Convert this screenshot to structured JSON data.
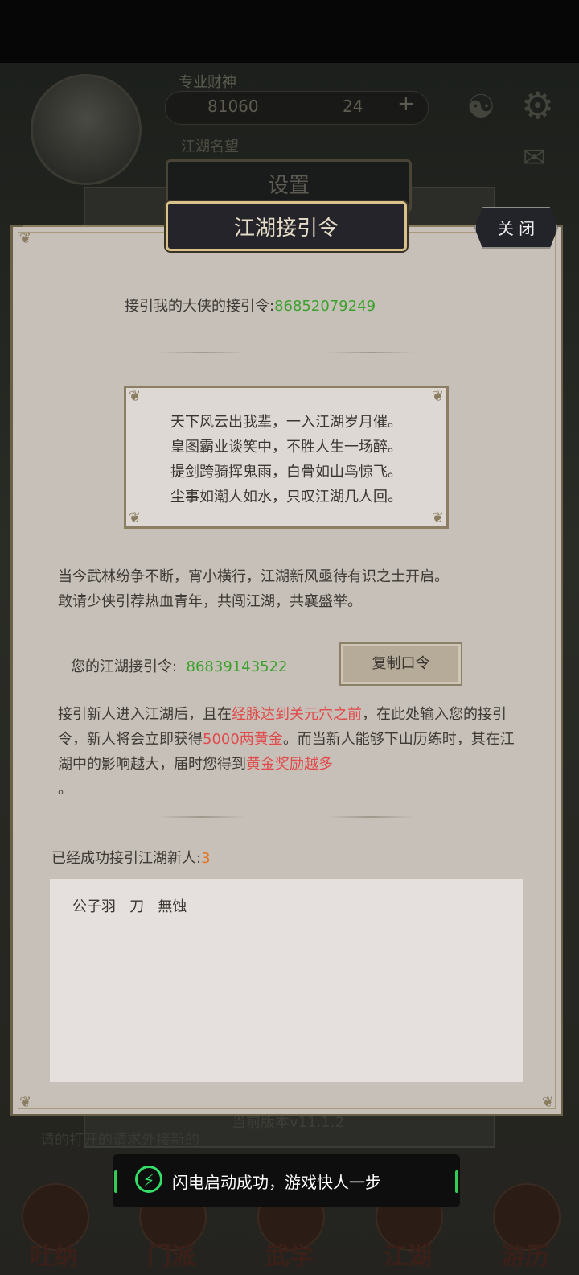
{
  "background": {
    "hud": {
      "player_name": "专业财神",
      "gold": "81060",
      "gems": "24",
      "plus": "+",
      "subtitle": "江湖名望"
    },
    "settings_title": "设置",
    "version": "当前版本v11.1.2",
    "note": "请的打开的请求外接新的"
  },
  "bottom_nav": [
    {
      "label": "吐纳"
    },
    {
      "label": "门派"
    },
    {
      "label": "武学"
    },
    {
      "label": "江湖"
    },
    {
      "label": "游历"
    }
  ],
  "dialog": {
    "title": "江湖接引令",
    "close_label": "关 闭",
    "inviter_label": "接引我的大侠的接引令:",
    "inviter_code": "86852079249",
    "poem": [
      "天下风云出我辈，一入江湖岁月催。",
      "皇图霸业谈笑中，不胜人生一场醉。",
      "提剑跨骑挥鬼雨，白骨如山鸟惊飞。",
      "尘事如潮人如水，只叹江湖几人回。"
    ],
    "intro": [
      "当今武林纷争不断，宵小横行，江湖新风亟待有识之士开启。",
      "敢请少侠引荐热血青年，共闯江湖，共襄盛举。"
    ],
    "my_code_label": "您的江湖接引令:",
    "my_code": "86839143522",
    "copy_button": "复制口令",
    "rules": {
      "p1": "接引新人进入江湖后，且在",
      "h1": "经脉达到关元穴之前",
      "p2": "，在此处输入您的接引令，新人将会立即获得",
      "h2": "5000两黄金",
      "p3": "。而当新人能够下山历练时，其在江湖中的影响越大，届时您得到",
      "h3": "黄金奖励越多",
      "p4": "。"
    },
    "success_label": "已经成功接引江湖新人:",
    "success_count": "3",
    "invitees": "公子羽   刀   無蚀"
  },
  "toast": {
    "text": "闪电启动成功，游戏快人一步",
    "icon": "lightning-icon"
  },
  "colors": {
    "panel_bg": "#c7c0b9",
    "highlight_green": "#3aa12b",
    "highlight_red": "#e04a4a",
    "highlight_orange": "#e0741e",
    "toast_accent": "#33cc55"
  }
}
